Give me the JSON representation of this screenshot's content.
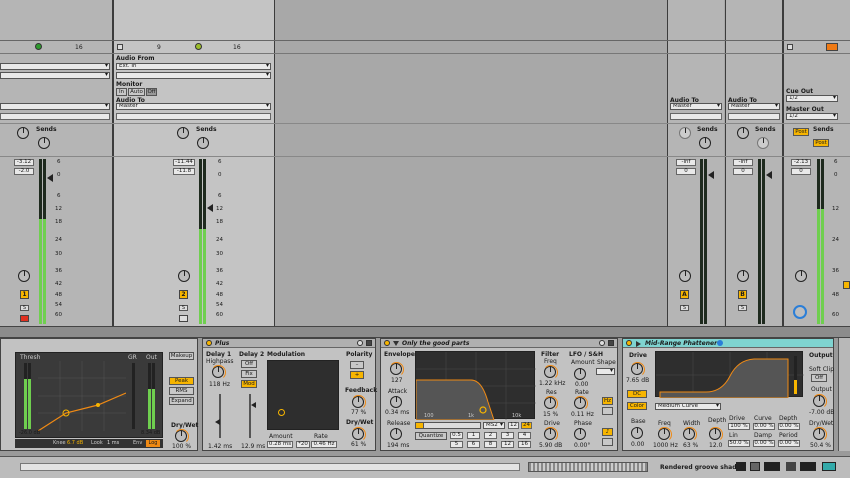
{
  "top": {
    "col1_mid": "9",
    "col1_right": "16",
    "col2_left": "9",
    "col2_right": "16"
  },
  "track_io": {
    "audio_from_label": "Audio From",
    "audio_from_value": "Ext. In",
    "audio_from_channel": "",
    "monitor_label": "Monitor",
    "monitor_in": "In",
    "monitor_auto": "Auto",
    "monitor_off": "Off",
    "audio_to_label": "Audio To",
    "audio_to_value": "Master"
  },
  "returns": {
    "a_audio_to_label": "Audio To",
    "a_audio_to_value": "Master",
    "b_audio_to_label": "Audio To",
    "b_audio_to_value": "Master",
    "cue_out_label": "Cue Out",
    "cue_out_value": "1/2",
    "master_out_label": "Master Out",
    "master_out_value": "1/2",
    "post": "Post"
  },
  "sends_label": "Sends",
  "knob_a": "A",
  "knob_b": "B",
  "tracks": [
    {
      "peak": "-3.12",
      "vol": "-2.0",
      "num": "1"
    },
    {
      "peak": "-11.44",
      "vol": "-11.8",
      "num": "2"
    },
    {
      "peak": "-inf",
      "vol": "0",
      "num": "A"
    },
    {
      "peak": "-inf",
      "vol": "0",
      "num": "B"
    },
    {
      "peak": "-2.13",
      "vol": "0",
      "num": ""
    }
  ],
  "scale": [
    "6",
    "0",
    "6",
    "12",
    "18",
    "24",
    "30",
    "36",
    "42",
    "48",
    "54",
    "60"
  ],
  "solo": "S",
  "compressor": {
    "thresh": "Thresh",
    "gr": "GR",
    "out": "Out",
    "makeup": "Makeup",
    "peak": "Peak",
    "rms": "RMS",
    "expand": "Expand",
    "dry_wet_label": "Dry/Wet",
    "dry_wet": "100 %",
    "thresh_val": "-26.0 dB",
    "out_val": "8.34 dB",
    "knee": "Knee",
    "knee_val": "6.7 dB",
    "look": "Look",
    "look_val": "1 ms",
    "env": "Env",
    "env_val": "Log"
  },
  "plus": {
    "title": "Plus",
    "delay1": "Delay 1",
    "highpass": "Highpass",
    "hp_val": "118 Hz",
    "delay2": "Delay 2",
    "off": "Off",
    "fix": "Fix",
    "mod": "Mod",
    "d1_time": "1.42 ms",
    "d2_time": "12.9 ms",
    "modulation": "Modulation",
    "amount_label": "Amount",
    "amount_val": "0.28 ms",
    "rate_label": "Rate",
    "rate_val": "0.46 Hz",
    "polarity": "Polarity",
    "pol_minus": "–",
    "pol_plus": "+",
    "feedback": "Feedback",
    "fb_val": "77 %",
    "drywet": "Dry/Wet",
    "dw_val": "61 %",
    "star": "*20"
  },
  "filter": {
    "title": "Only the good parts",
    "envelope": "Envelope",
    "env_val": "127",
    "attack": "Attack",
    "attack_val": "0.34 ms",
    "release": "Release",
    "release_val": "194 ms",
    "freq_axis": [
      "100",
      "1k",
      "10k"
    ],
    "type": "MS2",
    "slopes": [
      "12",
      "24"
    ],
    "quantize": "Quantize",
    "q_steps": [
      "0.5",
      "1",
      "2",
      "3",
      "4",
      "5",
      "6",
      "8",
      "12",
      "16"
    ],
    "filter_label": "Filter",
    "freq": "Freq",
    "freq_val": "1.22 kHz",
    "res": "Res",
    "res_val": "15 %",
    "drive": "Drive",
    "drive_val": "5.90 dB",
    "lfo": "LFO / S&H",
    "amount": "Amount",
    "amount_val": "0.00",
    "shape": "Shape",
    "rate": "Rate",
    "rate_val": "0.11 Hz",
    "hz": "Hz",
    "phase": "Phase",
    "phase_val": "0.00°",
    "note": "♪"
  },
  "phattener": {
    "title": "Mid-Range Phattener",
    "drive": "Drive",
    "drive_val": "7.65 dB",
    "dc": "DC",
    "color": "Color",
    "curve_sel": "Medium Curve",
    "base": "Base",
    "base_val": "0.00",
    "freq": "Freq",
    "freq_val": "1000 Hz",
    "width": "Width",
    "width_val": "63 %",
    "depth": "Depth",
    "depth_val": "12.0",
    "drive2": "Drive",
    "drive2_val": "100 %",
    "curve": "Curve",
    "curve_val": "0.00 %",
    "depth2": "Depth",
    "depth2_val": "0.00 %",
    "lin": "Lin",
    "lin_val": "50.0 %",
    "damp": "Damp",
    "damp_val": "0.00 %",
    "period": "Period",
    "period_val": "0.00 %",
    "output": "Output",
    "soft_clip": "Soft Clip",
    "sc_off": "Off",
    "output_label": "Output",
    "output_val": "-7.00 dB",
    "drywet": "Dry/Wet",
    "dw_val": "50.4 %"
  },
  "status": {
    "text": "Rendered groove shadow"
  }
}
